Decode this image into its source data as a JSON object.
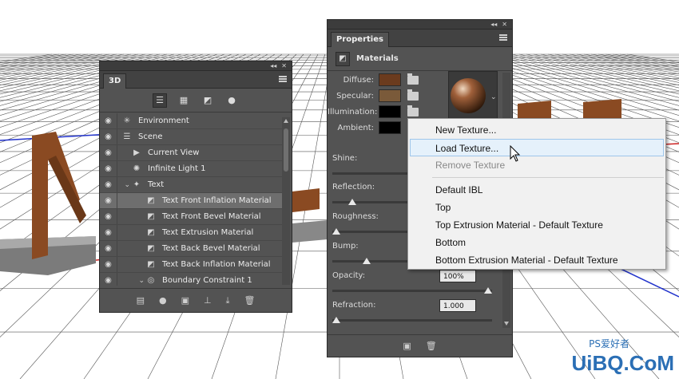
{
  "panel3d": {
    "tab": "3D",
    "layers": [
      {
        "label": "Environment",
        "icon": "environment-icon"
      },
      {
        "label": "Scene",
        "icon": "scene-icon"
      },
      {
        "label": "Current View",
        "icon": "camera-icon"
      },
      {
        "label": "Infinite Light 1",
        "icon": "light-icon"
      },
      {
        "label": "Text",
        "icon": "mesh-icon"
      },
      {
        "label": "Text Front Inflation Material",
        "icon": "material-icon",
        "selected": true
      },
      {
        "label": "Text Front Bevel Material",
        "icon": "material-icon"
      },
      {
        "label": "Text Extrusion Material",
        "icon": "material-icon"
      },
      {
        "label": "Text Back Bevel Material",
        "icon": "material-icon"
      },
      {
        "label": "Text Back Inflation Material",
        "icon": "material-icon"
      },
      {
        "label": "Boundary Constraint 1",
        "icon": "constraint-icon"
      }
    ]
  },
  "properties": {
    "tab": "Properties",
    "section_title": "Materials",
    "swatches": {
      "diffuse_label": "Diffuse:",
      "specular_label": "Specular:",
      "illumination_label": "Illumination:",
      "ambient_label": "Ambient:",
      "diffuse_color": "#6b3b1e",
      "specular_color": "#7a5a3a",
      "illumination_color": "#000000",
      "ambient_color": "#000000"
    },
    "sliders": {
      "shine_label": "Shine:",
      "reflection_label": "Reflection:",
      "roughness_label": "Roughness:",
      "bump_label": "Bump:",
      "opacity_label": "Opacity:",
      "opacity_value": "100%",
      "refraction_label": "Refraction:",
      "refraction_value": "1.000"
    }
  },
  "context_menu": {
    "items": [
      {
        "label": "New Texture...",
        "state": "normal"
      },
      {
        "label": "Load Texture...",
        "state": "hover"
      },
      {
        "label": "Remove Texture",
        "state": "disabled"
      },
      {
        "label": "Default IBL",
        "state": "normal"
      },
      {
        "label": "Top",
        "state": "normal"
      },
      {
        "label": "Top Extrusion Material - Default Texture",
        "state": "normal"
      },
      {
        "label": "Bottom",
        "state": "normal"
      },
      {
        "label": "Bottom Extrusion Material - Default Texture",
        "state": "normal"
      }
    ]
  },
  "watermark": {
    "text": "UiBQ.CoM",
    "sub": "PS爱好者"
  },
  "colors": {
    "panel_bg": "#535353",
    "menu_bg": "#f1f1f1",
    "menu_hover": "#e5f1fb",
    "brown_letters": "#8a4a22"
  }
}
